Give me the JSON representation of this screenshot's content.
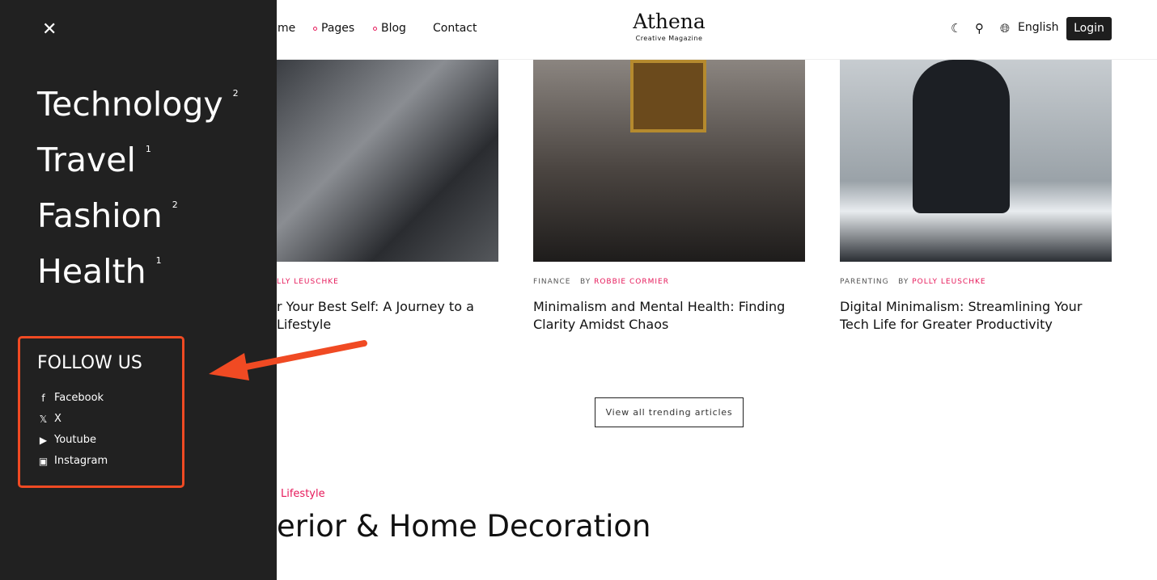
{
  "header": {
    "nav": [
      {
        "label": "Home",
        "visible": "me"
      },
      {
        "label": "Pages"
      },
      {
        "label": "Blog"
      },
      {
        "label": "Contact"
      }
    ],
    "logo": {
      "title": "Athena",
      "subtitle": "Creative Magazine"
    },
    "language": "English",
    "login": "Login"
  },
  "articles": [
    {
      "category": "",
      "author": "POLLY LEUSCHKE",
      "author_visible": "LLY LEUSCHKE",
      "title_visible": "r Your Best Self: A Journey to a Lifestyle"
    },
    {
      "category": "FINANCE",
      "by": "BY",
      "author": "ROBBIE CORMIER",
      "title": "Minimalism and Mental Health: Finding Clarity Amidst Chaos"
    },
    {
      "category": "PARENTING",
      "by": "BY",
      "author": "POLLY LEUSCHKE",
      "title": "Digital Minimalism: Streamlining Your Tech Life for Greater Productivity"
    }
  ],
  "view_all": "View all trending articles",
  "section": {
    "tag": "Lifestyle",
    "title_visible": "erior & Home Decoration"
  },
  "drawer": {
    "categories": [
      {
        "name": "Technology",
        "count": "2"
      },
      {
        "name": "Travel",
        "count": "1"
      },
      {
        "name": "Fashion",
        "count": "2"
      },
      {
        "name": "Health",
        "count": "1"
      }
    ],
    "follow_title": "FOLLOW US",
    "social": [
      {
        "label": "Facebook",
        "icon": "facebook-icon"
      },
      {
        "label": "X",
        "icon": "x-icon"
      },
      {
        "label": "Youtube",
        "icon": "youtube-icon"
      },
      {
        "label": "Instagram",
        "icon": "instagram-icon"
      }
    ]
  },
  "colors": {
    "accent": "#e6195a",
    "annotation": "#f04a23",
    "drawer": "#212121"
  }
}
